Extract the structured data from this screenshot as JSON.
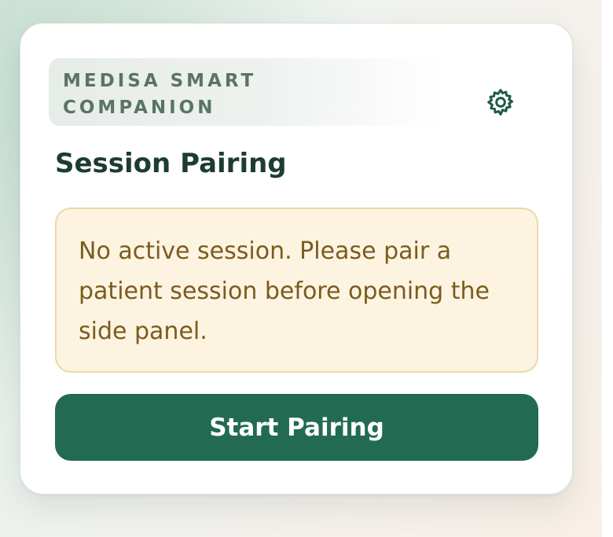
{
  "app": {
    "brand_name": "MEDISA SMART COMPANION"
  },
  "header": {
    "settings_icon": "gear-icon"
  },
  "main": {
    "title": "Session Pairing",
    "notice": {
      "message": "No active session. Please pair a patient session before opening the side panel."
    },
    "primary_button_label": "Start Pairing"
  },
  "colors": {
    "brand_green": "#226b52",
    "title_text": "#1c3d30",
    "brand_label_text": "#5b7368",
    "notice_background": "#fdf3e1",
    "notice_border": "#ecd8a6",
    "notice_text": "#7a5c1d",
    "button_text": "#ffffff"
  }
}
